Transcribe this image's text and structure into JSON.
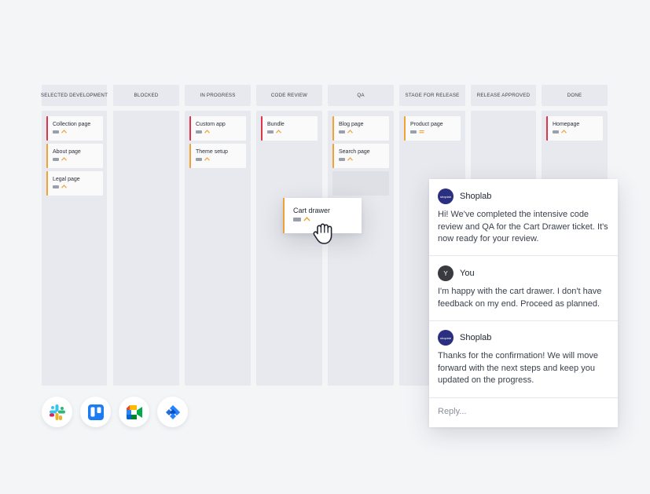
{
  "board": {
    "columns": [
      {
        "label": "SELECTED DEVELOPMENT",
        "cards": [
          {
            "title": "Collection page",
            "color": "red"
          },
          {
            "title": "About page",
            "color": "orange"
          },
          {
            "title": "Legal page",
            "color": "orange"
          }
        ]
      },
      {
        "label": "BLOCKED",
        "cards": []
      },
      {
        "label": "IN PROGRESS",
        "cards": [
          {
            "title": "Custom app",
            "color": "red"
          },
          {
            "title": "Theme setup",
            "color": "orange"
          }
        ]
      },
      {
        "label": "CODE REVIEW",
        "cards": [
          {
            "title": "Bundle",
            "color": "red"
          }
        ]
      },
      {
        "label": "QA",
        "cards": [
          {
            "title": "Blog page",
            "color": "orange"
          },
          {
            "title": "Search page",
            "color": "orange"
          }
        ]
      },
      {
        "label": "STAGE FOR RELEASE",
        "cards": [
          {
            "title": "Product page",
            "color": "orange"
          }
        ]
      },
      {
        "label": "RELEASE APPROVED",
        "cards": []
      },
      {
        "label": "DONE",
        "cards": [
          {
            "title": "Homepage",
            "color": "red"
          }
        ]
      }
    ]
  },
  "drag_card": {
    "title": "Cart drawer",
    "icon": "grab-hand-icon"
  },
  "chat": {
    "messages": [
      {
        "sender": "Shoplab",
        "avatar_text": "shoplab",
        "text": "Hi! We've completed the intensive code review and QA for the Cart Drawer ticket. It's now ready for your review."
      },
      {
        "sender": "You",
        "avatar_text": "Y",
        "text": "I'm happy with the cart drawer. I don't have feedback on my end. Proceed as planned."
      },
      {
        "sender": "Shoplab",
        "avatar_text": "shoplab",
        "text": "Thanks for the confirmation! We will move forward with the next steps and keep you updated on the progress."
      }
    ],
    "reply_placeholder": "Reply..."
  },
  "integrations": [
    "slack-icon",
    "trello-icon",
    "google-meet-icon",
    "jira-icon"
  ],
  "colors": {
    "red": "#e0344b",
    "orange": "#f0a334",
    "brand": "#2b2f80",
    "column_bg": "#e8e9ee",
    "page_bg": "#f4f5f7"
  }
}
